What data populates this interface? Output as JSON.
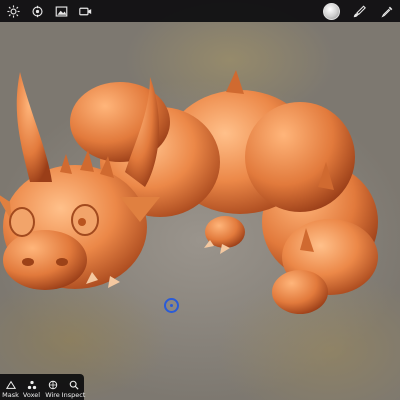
{
  "toolbar": {
    "left_icons": [
      "settings-sun-icon",
      "scene-gear-icon",
      "image-icon",
      "video-camera-icon"
    ],
    "right_icons": [
      "material-swatch",
      "brush-icon",
      "eyedropper-icon"
    ]
  },
  "viewport": {
    "model": "orange clay dragon sculpt",
    "pivot_color": "#2a5bd7"
  },
  "bottom_tools": {
    "mask_label": "Mask",
    "voxel_label": "Voxel",
    "wire_label": "Wire",
    "inspect_label": "Inspect"
  },
  "colors": {
    "toolbar_bg": "#0c0c0e",
    "model_orange": "#e8834a",
    "pivot_blue": "#2a5bd7"
  }
}
